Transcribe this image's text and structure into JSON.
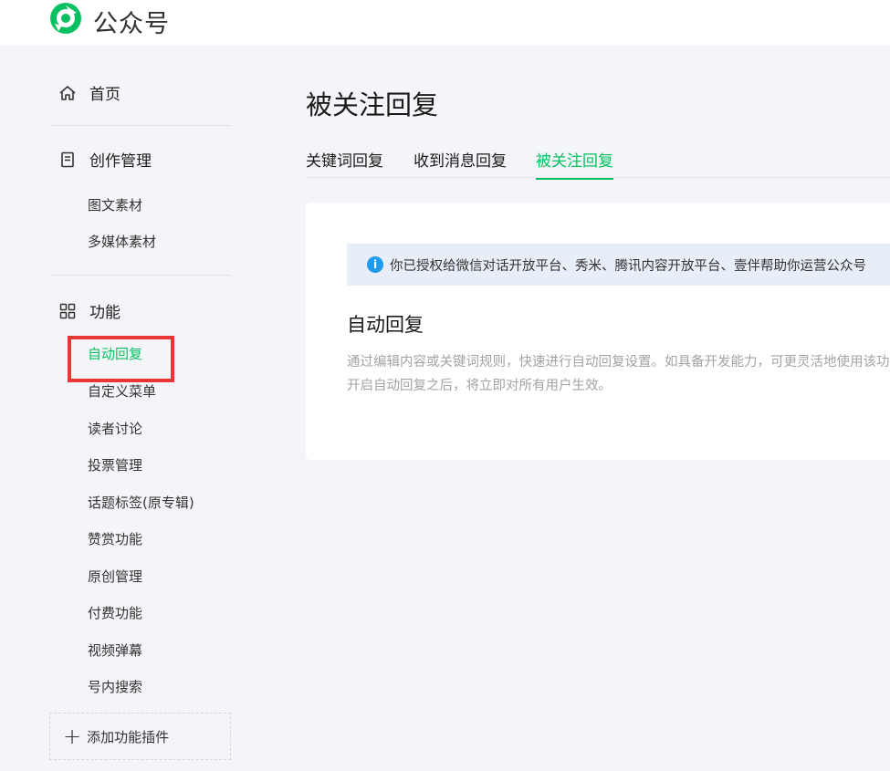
{
  "header": {
    "app_title": "公众号",
    "logo_icon": "wechat-official-account-logo",
    "brand_color": "#07c160"
  },
  "sidebar": {
    "home_label": "首页",
    "creation": {
      "label": "创作管理",
      "items": [
        "图文素材",
        "多媒体素材"
      ]
    },
    "features": {
      "label": "功能",
      "items": [
        "自动回复",
        "自定义菜单",
        "读者讨论",
        "投票管理",
        "话题标签(原专辑)",
        "赞赏功能",
        "原创管理",
        "付费功能",
        "视频弹幕",
        "号内搜索"
      ],
      "active_item": "自动回复"
    },
    "add_plugin_label": "添加功能插件"
  },
  "main": {
    "page_title": "被关注回复",
    "tabs": [
      {
        "label": "关键词回复",
        "active": false
      },
      {
        "label": "收到消息回复",
        "active": false
      },
      {
        "label": "被关注回复",
        "active": true
      }
    ],
    "notice_text": "你已授权给微信对话开放平台、秀米、腾讯内容开放平台、壹伴帮助你运营公众号",
    "section_title": "自动回复",
    "desc_line1": "通过编辑内容或关键词规则，快速进行自动回复设置。如具备开发能力，可更灵活地使用该功能。",
    "desc_line2": "开启自动回复之后，将立即对所有用户生效。"
  },
  "colors": {
    "accent": "#07c160",
    "annotation_box": "#ea3535",
    "notice_bg": "#e8eef8",
    "info_icon": "#1e9bf0"
  }
}
